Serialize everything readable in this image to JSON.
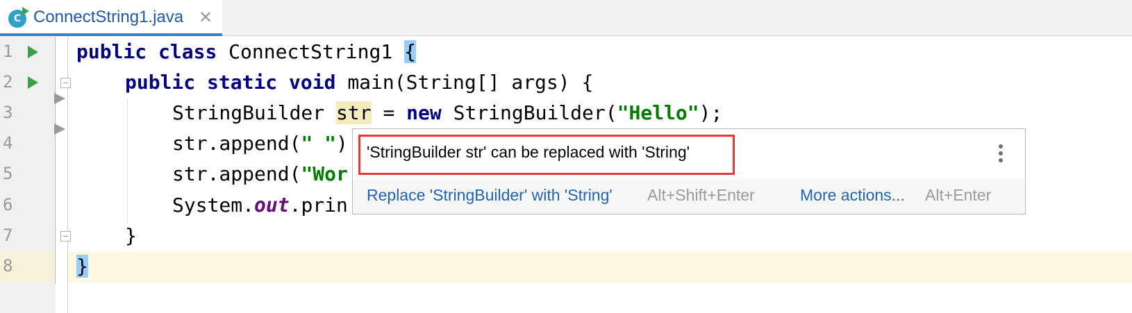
{
  "tab": {
    "title": "ConnectString1.java",
    "icon_letter": "C",
    "close": "✕"
  },
  "line_numbers": [
    "1",
    "2",
    "3",
    "4",
    "5",
    "6",
    "7",
    "8"
  ],
  "code": {
    "l1": {
      "kw1": "public",
      "kw2": "class",
      "name": "ConnectString1",
      "brace": "{"
    },
    "l2": {
      "kw1": "public",
      "kw2": "static",
      "kw3": "void",
      "rest": "main(String[] args) {"
    },
    "l3": {
      "type": "StringBuilder",
      "var": "str",
      "eq": " = ",
      "kw": "new",
      "ctor": "StringBuilder(",
      "str": "\"Hello\"",
      "end": ");"
    },
    "l4": {
      "call": "str.append(",
      "str": "\" \"",
      "end": ")"
    },
    "l5": {
      "call": "str.append(",
      "str": "\"Wor"
    },
    "l6": {
      "pre": "System.",
      "field": "out",
      "post": ".prin"
    },
    "l7": {
      "brace": "}"
    },
    "l8": {
      "brace": "}"
    }
  },
  "popup": {
    "message": "'StringBuilder str' can be replaced with 'String'",
    "action_label": "Replace 'StringBuilder' with 'String'",
    "action_shortcut": "Alt+Shift+Enter",
    "more_label": "More actions...",
    "more_shortcut": "Alt+Enter"
  },
  "colors": {
    "keyword": "#000080",
    "string": "#007a00",
    "field": "#660e7a",
    "link": "#1f63b5",
    "highlight_border": "#e53935",
    "current_line": "#fdf8e2",
    "brace_match": "#99ccff"
  }
}
